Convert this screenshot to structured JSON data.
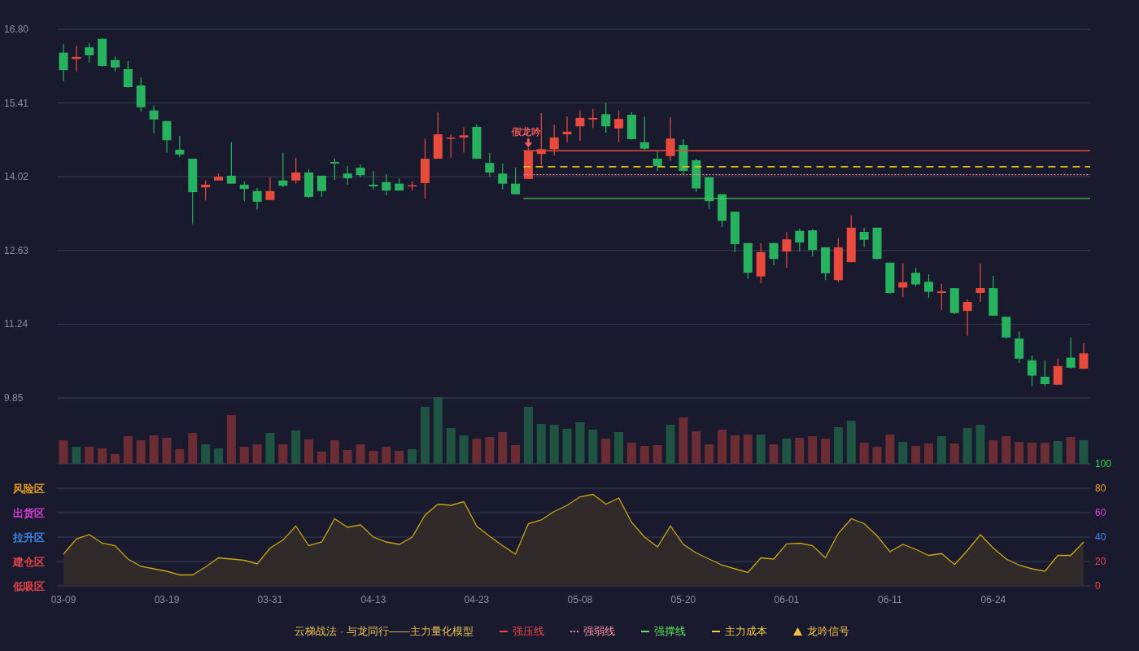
{
  "price_chart": {
    "chart_data": {
      "type": "candlestick",
      "grid": true,
      "ylim": [
        9.85,
        16.8
      ],
      "yticks": [
        {
          "value": 16.8,
          "label": "16.80"
        },
        {
          "value": 15.41,
          "label": "15.41"
        },
        {
          "value": 14.02,
          "label": "14.02"
        },
        {
          "value": 12.63,
          "label": "12.63"
        },
        {
          "value": 11.24,
          "label": "11.24"
        },
        {
          "value": 9.85,
          "label": "9.85"
        }
      ],
      "ohlc": [
        [
          16.36,
          16.52,
          15.82,
          16.03
        ],
        [
          16.24,
          16.49,
          16.0,
          16.28
        ],
        [
          16.46,
          16.54,
          16.17,
          16.31
        ],
        [
          16.62,
          16.63,
          16.1,
          16.11
        ],
        [
          16.22,
          16.29,
          16.0,
          16.08
        ],
        [
          16.05,
          16.2,
          15.7,
          15.71
        ],
        [
          15.74,
          15.89,
          15.25,
          15.33
        ],
        [
          15.27,
          15.36,
          14.84,
          15.1
        ],
        [
          15.07,
          15.07,
          14.47,
          14.71
        ],
        [
          14.53,
          14.79,
          14.39,
          14.44
        ],
        [
          14.36,
          14.36,
          13.13,
          13.73
        ],
        [
          13.82,
          13.95,
          13.58,
          13.87
        ],
        [
          13.95,
          14.08,
          13.95,
          14.02
        ],
        [
          14.04,
          14.67,
          13.89,
          13.89
        ],
        [
          13.87,
          13.93,
          13.56,
          13.79
        ],
        [
          13.75,
          13.81,
          13.4,
          13.55
        ],
        [
          13.58,
          14.01,
          13.58,
          13.75
        ],
        [
          13.95,
          14.47,
          13.82,
          13.85
        ],
        [
          13.95,
          14.38,
          13.89,
          14.1
        ],
        [
          14.1,
          14.16,
          13.62,
          13.64
        ],
        [
          14.04,
          14.04,
          13.64,
          13.75
        ],
        [
          14.3,
          14.36,
          13.96,
          14.27
        ],
        [
          14.08,
          14.22,
          13.87,
          13.99
        ],
        [
          14.19,
          14.25,
          14.01,
          14.05
        ],
        [
          13.87,
          14.13,
          13.78,
          13.84
        ],
        [
          13.92,
          14.07,
          13.67,
          13.76
        ],
        [
          13.89,
          13.99,
          13.76,
          13.76
        ],
        [
          13.84,
          13.93,
          13.76,
          13.86
        ],
        [
          13.9,
          14.74,
          13.61,
          14.36
        ],
        [
          14.36,
          15.24,
          14.36,
          14.82
        ],
        [
          14.74,
          14.82,
          14.38,
          14.76
        ],
        [
          14.76,
          14.95,
          14.48,
          14.8
        ],
        [
          14.96,
          15.01,
          14.36,
          14.36
        ],
        [
          14.28,
          14.47,
          14.02,
          14.1
        ],
        [
          14.08,
          14.27,
          13.78,
          13.89
        ],
        [
          13.89,
          14.19,
          13.69,
          13.69
        ],
        [
          13.98,
          14.56,
          13.98,
          14.51
        ],
        [
          14.45,
          15.22,
          14.24,
          14.54
        ],
        [
          14.54,
          15.0,
          14.42,
          14.76
        ],
        [
          14.82,
          15.16,
          14.67,
          14.87
        ],
        [
          14.97,
          15.27,
          14.7,
          15.13
        ],
        [
          15.1,
          15.3,
          14.94,
          15.13
        ],
        [
          15.2,
          15.41,
          14.85,
          14.97
        ],
        [
          14.93,
          15.27,
          14.67,
          15.11
        ],
        [
          15.19,
          15.24,
          14.72,
          14.73
        ],
        [
          14.67,
          15.16,
          14.53,
          14.55
        ],
        [
          14.36,
          14.5,
          14.13,
          14.22
        ],
        [
          14.41,
          15.14,
          14.31,
          14.74
        ],
        [
          14.62,
          14.73,
          14.05,
          14.13
        ],
        [
          14.33,
          14.36,
          13.73,
          13.8
        ],
        [
          14.01,
          14.01,
          13.41,
          13.56
        ],
        [
          13.69,
          13.69,
          13.07,
          13.19
        ],
        [
          13.36,
          13.36,
          12.6,
          12.75
        ],
        [
          12.77,
          12.77,
          12.09,
          12.21
        ],
        [
          12.14,
          12.77,
          12.01,
          12.6
        ],
        [
          12.77,
          12.77,
          12.35,
          12.47
        ],
        [
          12.61,
          12.98,
          12.3,
          12.84
        ],
        [
          13.0,
          13.04,
          12.61,
          12.78
        ],
        [
          13.01,
          13.03,
          12.52,
          12.64
        ],
        [
          12.69,
          12.69,
          12.07,
          12.2
        ],
        [
          12.07,
          12.86,
          12.03,
          12.69
        ],
        [
          12.41,
          13.29,
          12.41,
          13.06
        ],
        [
          12.98,
          13.06,
          12.69,
          12.83
        ],
        [
          13.06,
          13.06,
          12.46,
          12.47
        ],
        [
          12.4,
          12.4,
          11.81,
          11.83
        ],
        [
          11.93,
          12.38,
          11.75,
          12.03
        ],
        [
          12.21,
          12.3,
          11.95,
          11.99
        ],
        [
          12.04,
          12.18,
          11.74,
          11.85
        ],
        [
          11.83,
          12.0,
          11.51,
          11.86
        ],
        [
          11.92,
          11.92,
          11.43,
          11.45
        ],
        [
          11.49,
          11.71,
          11.02,
          11.66
        ],
        [
          11.83,
          12.38,
          11.66,
          11.92
        ],
        [
          11.92,
          12.15,
          11.4,
          11.4
        ],
        [
          11.38,
          11.38,
          10.97,
          10.99
        ],
        [
          10.97,
          11.1,
          10.51,
          10.59
        ],
        [
          10.56,
          10.65,
          10.07,
          10.27
        ],
        [
          10.25,
          10.56,
          10.07,
          10.11
        ],
        [
          10.1,
          10.59,
          10.1,
          10.45
        ],
        [
          10.61,
          10.99,
          10.4,
          10.42
        ],
        [
          10.4,
          10.89,
          10.4,
          10.69
        ]
      ],
      "annotations": [
        {
          "text": "假龙吟"
        }
      ],
      "ref_lines": [
        {
          "axis": "y",
          "value": 14.51,
          "color": "#e8473d"
        },
        {
          "axis": "y",
          "value": 14.06,
          "color": "#e8899a"
        },
        {
          "axis": "y",
          "value": 13.61,
          "color": "#4cc44c"
        },
        {
          "axis": "y",
          "value": 14.21,
          "color": "#e0c010"
        }
      ]
    },
    "signal_flags": [
      false,
      false,
      false,
      false,
      false,
      false,
      false,
      false,
      false,
      false,
      false,
      false,
      false,
      false,
      false,
      false,
      false,
      false,
      false,
      false,
      false,
      false,
      false,
      false,
      false,
      false,
      false,
      false,
      false,
      false,
      false,
      false,
      false,
      false,
      false,
      false,
      true,
      false,
      false,
      false,
      false,
      false,
      false,
      false,
      false,
      false,
      false,
      false,
      false,
      false,
      false,
      false,
      false,
      false,
      false,
      false,
      false,
      false,
      false,
      false,
      false,
      false,
      false,
      false,
      false,
      false,
      false,
      false,
      false,
      false,
      false,
      false,
      false,
      false,
      false,
      false,
      false,
      false,
      false,
      false
    ]
  },
  "indicator_chart": {
    "zones": [
      {
        "label": "风险区",
        "color": "#f0a020"
      },
      {
        "label": "出货区",
        "color": "#e040e0"
      },
      {
        "label": "拉升区",
        "color": "#3d8ef0"
      },
      {
        "label": "建仓区",
        "color": "#f04848"
      },
      {
        "label": "低吸区",
        "color": "#f04848"
      }
    ],
    "tick_styles": [
      {
        "color": "#33dd44"
      },
      {
        "color": "#f0a020"
      },
      {
        "color": "#e040e0"
      },
      {
        "color": "#3d8ef0"
      },
      {
        "color": "#f04848"
      },
      {
        "color": "#f04848"
      }
    ],
    "chart_data": {
      "type": "area",
      "grid": true,
      "ylim": [
        0,
        100
      ],
      "yticks": [
        {
          "value": 100,
          "label": "100"
        },
        {
          "value": 80,
          "label": "80"
        },
        {
          "value": 60,
          "label": "60"
        },
        {
          "value": 40,
          "label": "40"
        },
        {
          "value": 20,
          "label": "20"
        },
        {
          "value": 0,
          "label": "0"
        }
      ],
      "categories": [
        "03-09",
        null,
        null,
        null,
        null,
        null,
        null,
        null,
        "03-19",
        null,
        null,
        null,
        null,
        null,
        null,
        null,
        "03-31",
        null,
        null,
        null,
        null,
        null,
        null,
        null,
        "04-13",
        null,
        null,
        null,
        null,
        null,
        null,
        null,
        "04-23",
        null,
        null,
        null,
        null,
        null,
        null,
        null,
        "05-08",
        null,
        null,
        null,
        null,
        null,
        null,
        null,
        "05-20",
        null,
        null,
        null,
        null,
        null,
        null,
        null,
        "06-01",
        null,
        null,
        null,
        null,
        null,
        null,
        null,
        "06-11",
        null,
        null,
        null,
        null,
        null,
        null,
        null,
        "06-24",
        null,
        null,
        null,
        null,
        null,
        null,
        null
      ],
      "series": [
        {
          "color": "#c9a60f",
          "values": [
            26,
            38.5,
            42,
            35,
            33,
            22,
            16,
            14,
            12,
            9,
            9,
            15.5,
            23,
            22,
            21,
            18,
            31,
            37.6,
            49,
            33,
            36,
            55,
            48,
            50,
            40,
            36,
            34,
            40,
            58,
            67,
            66,
            69,
            49,
            40.6,
            33,
            26,
            51,
            54,
            61,
            66,
            73,
            75,
            67,
            72,
            52,
            40,
            32,
            49,
            34,
            27,
            22,
            17,
            14,
            11,
            23,
            22,
            34.5,
            35,
            33,
            23,
            43,
            55,
            51,
            41,
            28,
            34,
            30,
            25,
            26.5,
            17.5,
            29,
            42,
            31,
            22,
            17,
            14,
            12,
            25,
            25,
            36
          ]
        }
      ]
    }
  },
  "legend": {
    "title": "云梯战法 · 与龙同行——主力量化模型",
    "items": [
      {
        "kind": "solid",
        "label": "强压线",
        "color": "#f04848"
      },
      {
        "kind": "dotted",
        "label": "强弱线",
        "color": "#ff8fa3"
      },
      {
        "kind": "solid",
        "label": "强撑线",
        "color": "#5ee35e"
      },
      {
        "kind": "dashed",
        "label": "主力成本",
        "color": "#f5d142"
      },
      {
        "kind": "triangle",
        "label": "龙吟信号",
        "color": "#f5c242"
      }
    ]
  }
}
